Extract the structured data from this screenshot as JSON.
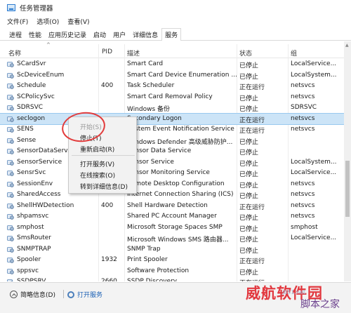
{
  "window": {
    "title": "任务管理器"
  },
  "menu": [
    "文件(F)",
    "选项(O)",
    "查看(V)"
  ],
  "tabs": [
    {
      "label": "进程",
      "active": false
    },
    {
      "label": "性能",
      "active": false
    },
    {
      "label": "应用历史记录",
      "active": false
    },
    {
      "label": "启动",
      "active": false
    },
    {
      "label": "用户",
      "active": false
    },
    {
      "label": "详细信息",
      "active": false
    },
    {
      "label": "服务",
      "active": true
    }
  ],
  "columns": {
    "name": "名称",
    "pid": "PID",
    "desc": "描述",
    "status": "状态",
    "group": "组"
  },
  "rows": [
    {
      "name": "SCardSvr",
      "pid": "",
      "desc": "Smart Card",
      "status": "已停止",
      "group": "LocalService..."
    },
    {
      "name": "ScDeviceEnum",
      "pid": "",
      "desc": "Smart Card Device Enumeration ...",
      "status": "已停止",
      "group": "LocalSystem..."
    },
    {
      "name": "Schedule",
      "pid": "400",
      "desc": "Task Scheduler",
      "status": "正在运行",
      "group": "netsvcs"
    },
    {
      "name": "SCPolicySvc",
      "pid": "",
      "desc": "Smart Card Removal Policy",
      "status": "已停止",
      "group": "netsvcs"
    },
    {
      "name": "SDRSVC",
      "pid": "",
      "desc": "Windows 备份",
      "status": "已停止",
      "group": "SDRSVC"
    },
    {
      "name": "seclogon",
      "pid": "",
      "desc": "Secondary Logon",
      "status": "正在运行",
      "group": "netsvcs",
      "selected": true
    },
    {
      "name": "SENS",
      "pid": "",
      "desc": "System Event Notification Service",
      "status": "正在运行",
      "group": "netsvcs"
    },
    {
      "name": "Sense",
      "pid": "",
      "desc": "Windows Defender 高级威胁防护...",
      "status": "已停止",
      "group": ""
    },
    {
      "name": "SensorDataServ...",
      "pid": "",
      "desc": "Sensor Data Service",
      "status": "已停止",
      "group": ""
    },
    {
      "name": "SensorService",
      "pid": "",
      "desc": "Sensor Service",
      "status": "已停止",
      "group": "LocalSystem..."
    },
    {
      "name": "SensrSvc",
      "pid": "",
      "desc": "Sensor Monitoring Service",
      "status": "已停止",
      "group": "LocalService..."
    },
    {
      "name": "SessionEnv",
      "pid": "",
      "desc": "Remote Desktop Configuration",
      "status": "已停止",
      "group": "netsvcs"
    },
    {
      "name": "SharedAccess",
      "pid": "",
      "desc": "Internet Connection Sharing (ICS)",
      "status": "已停止",
      "group": "netsvcs"
    },
    {
      "name": "ShellHWDetection",
      "pid": "400",
      "desc": "Shell Hardware Detection",
      "status": "正在运行",
      "group": "netsvcs"
    },
    {
      "name": "shpamsvc",
      "pid": "",
      "desc": "Shared PC Account Manager",
      "status": "已停止",
      "group": "netsvcs"
    },
    {
      "name": "smphost",
      "pid": "",
      "desc": "Microsoft Storage Spaces SMP",
      "status": "已停止",
      "group": "smphost"
    },
    {
      "name": "SmsRouter",
      "pid": "",
      "desc": "Microsoft Windows SMS 路由器...",
      "status": "已停止",
      "group": "LocalService..."
    },
    {
      "name": "SNMPTRAP",
      "pid": "",
      "desc": "SNMP Trap",
      "status": "已停止",
      "group": ""
    },
    {
      "name": "Spooler",
      "pid": "1932",
      "desc": "Print Spooler",
      "status": "正在运行",
      "group": ""
    },
    {
      "name": "sppsvc",
      "pid": "",
      "desc": "Software Protection",
      "status": "已停止",
      "group": ""
    },
    {
      "name": "SSDPSRV",
      "pid": "2660",
      "desc": "SSDP Discovery",
      "status": "正在运行",
      "group": ""
    }
  ],
  "context_menu": {
    "items": [
      {
        "label": "开始(S)",
        "disabled": true
      },
      {
        "label": "停止(T)",
        "disabled": false
      },
      {
        "label": "重新启动(R)",
        "disabled": false
      },
      {
        "label": "打开服务(V)",
        "disabled": false
      },
      {
        "label": "在线搜索(O)",
        "disabled": false
      },
      {
        "label": "转到详细信息(D)",
        "disabled": false
      }
    ]
  },
  "footer": {
    "fewer_details": "简略信息(D)",
    "open_services": "打开服务"
  },
  "watermark": {
    "site": "jb51.net",
    "brand": "威航软件园",
    "slogan": "脚本之家"
  },
  "colors": {
    "selected_row": "#cce4f7",
    "accent": "#1a5fb4",
    "annotation": "#e23b3b"
  }
}
